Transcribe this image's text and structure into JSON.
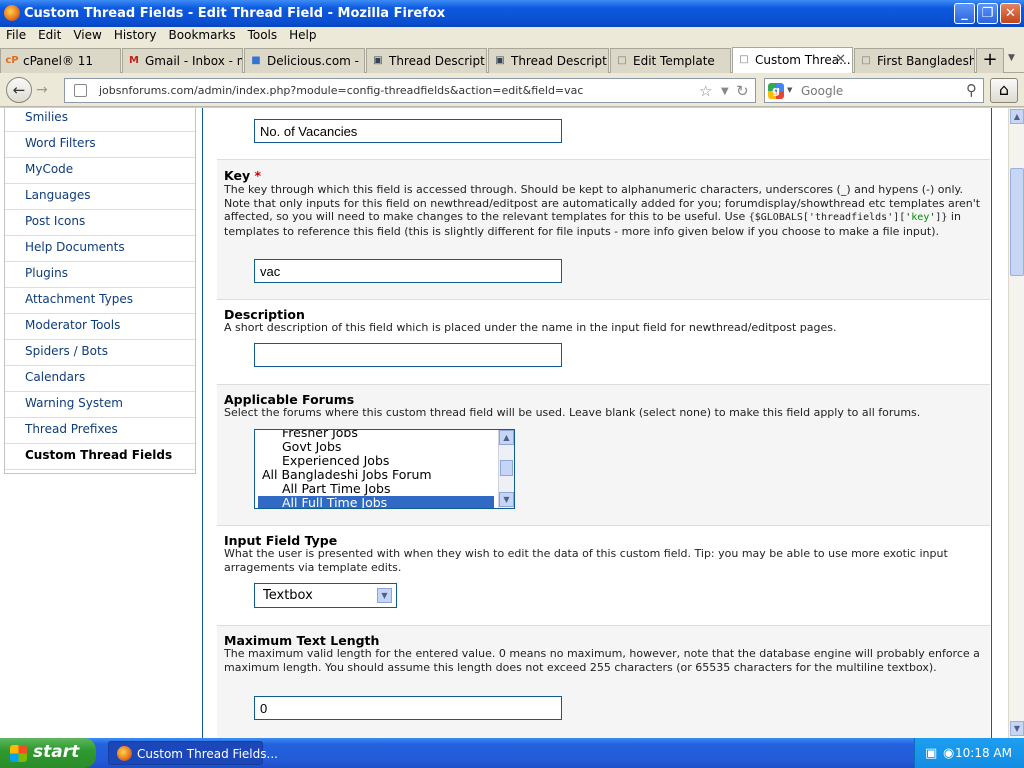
{
  "window": {
    "title": "Custom Thread Fields - Edit Thread Field - Mozilla Firefox"
  },
  "menu": [
    "File",
    "Edit",
    "View",
    "History",
    "Bookmarks",
    "Tools",
    "Help"
  ],
  "tabs": [
    {
      "label": "cPanel® 11",
      "icon": "cP"
    },
    {
      "label": "Gmail - Inbox - m...",
      "icon": "M"
    },
    {
      "label": "Delicious.com - Di...",
      "icon": "■"
    },
    {
      "label": "Thread Descriptions",
      "icon": "▣"
    },
    {
      "label": "Thread Descriptions",
      "icon": "▣"
    },
    {
      "label": "Edit Template",
      "icon": "□"
    },
    {
      "label": "Custom Threa...",
      "icon": "□",
      "active": true
    },
    {
      "label": "First Bangladeshi ...",
      "icon": "□"
    }
  ],
  "nav": {
    "url": "jobsnforums.com/admin/index.php?module=config-threadfields&action=edit&field=vac",
    "search_placeholder": "Google"
  },
  "sidebar": {
    "items": [
      "Smilies",
      "Word Filters",
      "MyCode",
      "Languages",
      "Post Icons",
      "Help Documents",
      "Plugins",
      "Attachment Types",
      "Moderator Tools",
      "Spiders / Bots",
      "Calendars",
      "Warning System",
      "Thread Prefixes",
      "Custom Thread Fields"
    ]
  },
  "form": {
    "title_value": "No. of Vacancies",
    "key_label": "Key",
    "key_required": "*",
    "key_desc_1": "The key through which this field is accessed through. Should be kept to alphanumeric characters, underscores (_) and hypens (-) only. Note that only inputs for this field on newthread/editpost are automatically added for you; forumdisplay/showthread etc templates aren't affected, so you will need to make changes to the relevant templates for this to be useful. Use",
    "key_code_a": "{$GLOBALS['threadfields']['",
    "key_code_b": "key",
    "key_code_c": "']}",
    "key_desc_2": "in templates to reference this field (this is slightly different for file inputs - more info given below if you choose to make a file input).",
    "key_value": "vac",
    "desc_label": "Description",
    "desc_desc": "A short description of this field which is placed under the name in the input field for newthread/editpost pages.",
    "desc_value": "",
    "forums_label": "Applicable Forums",
    "forums_desc": "Select the forums where this custom thread field will be used. Leave blank (select none) to make this field apply to all forums.",
    "forums_options": [
      {
        "label": "Fresher Jobs",
        "indent": 1
      },
      {
        "label": "Govt Jobs",
        "indent": 1
      },
      {
        "label": "Experienced Jobs",
        "indent": 1
      },
      {
        "label": "All Bangladeshi Jobs Forum",
        "indent": 0
      },
      {
        "label": "All Part Time Jobs",
        "indent": 1
      },
      {
        "label": "All Full Time Jobs",
        "indent": 1,
        "selected": true
      }
    ],
    "type_label": "Input Field Type",
    "type_desc": "What the user is presented with when they wish to edit the data of this custom field. Tip: you may be able to use more exotic input arragements via template edits.",
    "type_value": "Textbox",
    "maxlen_label": "Maximum Text Length",
    "maxlen_desc": "The maximum valid length for the entered value. 0 means no maximum, however, note that the database engine will probably enforce a maximum length. You should assume this length does not exceed 255 characters (or 65535 characters for the multiline textbox).",
    "maxlen_value": "0"
  },
  "taskbar": {
    "start": "start",
    "item": "Custom Thread Fields...",
    "clock": "10:18 AM"
  }
}
